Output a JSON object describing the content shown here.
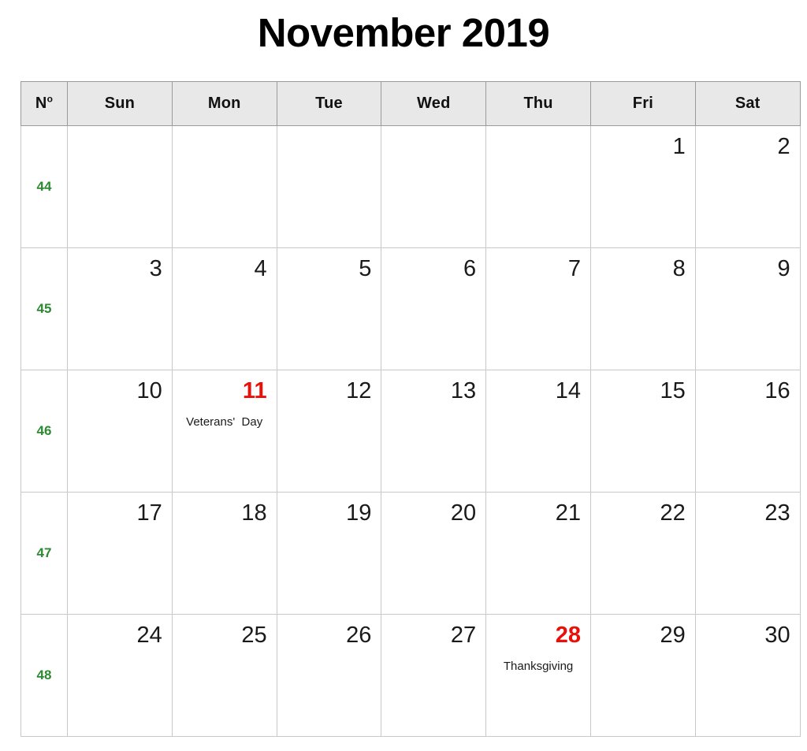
{
  "title": "November 2019",
  "header": {
    "week_number_label": "N",
    "week_number_sup": "o",
    "days": [
      "Sun",
      "Mon",
      "Tue",
      "Wed",
      "Thu",
      "Fri",
      "Sat"
    ]
  },
  "colors": {
    "holiday": "#ea1009",
    "week_number": "#2d8a33",
    "header_background": "#e8e8e8",
    "header_border": "#9a9a9a",
    "cell_border": "#c8c8c8",
    "text": "#1a1a1a"
  },
  "weeks": [
    {
      "week_number": "44",
      "days": [
        {
          "date": "",
          "event": "",
          "holiday": false
        },
        {
          "date": "",
          "event": "",
          "holiday": false
        },
        {
          "date": "",
          "event": "",
          "holiday": false
        },
        {
          "date": "",
          "event": "",
          "holiday": false
        },
        {
          "date": "",
          "event": "",
          "holiday": false
        },
        {
          "date": "1",
          "event": "",
          "holiday": false
        },
        {
          "date": "2",
          "event": "",
          "holiday": false
        }
      ]
    },
    {
      "week_number": "45",
      "days": [
        {
          "date": "3",
          "event": "",
          "holiday": false
        },
        {
          "date": "4",
          "event": "",
          "holiday": false
        },
        {
          "date": "5",
          "event": "",
          "holiday": false
        },
        {
          "date": "6",
          "event": "",
          "holiday": false
        },
        {
          "date": "7",
          "event": "",
          "holiday": false
        },
        {
          "date": "8",
          "event": "",
          "holiday": false
        },
        {
          "date": "9",
          "event": "",
          "holiday": false
        }
      ]
    },
    {
      "week_number": "46",
      "days": [
        {
          "date": "10",
          "event": "",
          "holiday": false
        },
        {
          "date": "11",
          "event": "Veterans'  Day",
          "holiday": true
        },
        {
          "date": "12",
          "event": "",
          "holiday": false
        },
        {
          "date": "13",
          "event": "",
          "holiday": false
        },
        {
          "date": "14",
          "event": "",
          "holiday": false
        },
        {
          "date": "15",
          "event": "",
          "holiday": false
        },
        {
          "date": "16",
          "event": "",
          "holiday": false
        }
      ]
    },
    {
      "week_number": "47",
      "days": [
        {
          "date": "17",
          "event": "",
          "holiday": false
        },
        {
          "date": "18",
          "event": "",
          "holiday": false
        },
        {
          "date": "19",
          "event": "",
          "holiday": false
        },
        {
          "date": "20",
          "event": "",
          "holiday": false
        },
        {
          "date": "21",
          "event": "",
          "holiday": false
        },
        {
          "date": "22",
          "event": "",
          "holiday": false
        },
        {
          "date": "23",
          "event": "",
          "holiday": false
        }
      ]
    },
    {
      "week_number": "48",
      "days": [
        {
          "date": "24",
          "event": "",
          "holiday": false
        },
        {
          "date": "25",
          "event": "",
          "holiday": false
        },
        {
          "date": "26",
          "event": "",
          "holiday": false
        },
        {
          "date": "27",
          "event": "",
          "holiday": false
        },
        {
          "date": "28",
          "event": "Thanksgiving",
          "holiday": true
        },
        {
          "date": "29",
          "event": "",
          "holiday": false
        },
        {
          "date": "30",
          "event": "",
          "holiday": false
        }
      ]
    }
  ]
}
